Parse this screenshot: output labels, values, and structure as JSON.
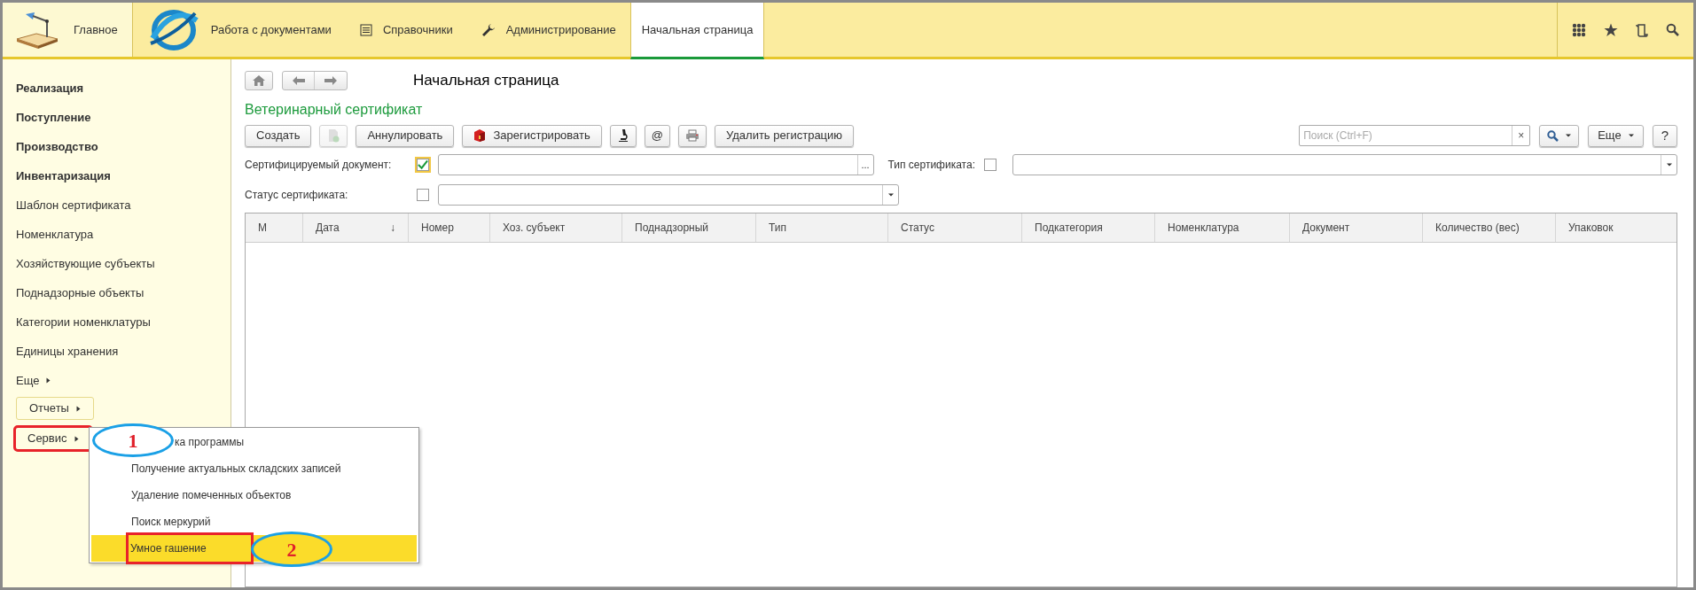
{
  "top_nav": {
    "items": [
      {
        "label": "Главное",
        "kind": "home",
        "selected": false
      },
      {
        "label": "Работа с документами",
        "kind": "section",
        "selected": false
      },
      {
        "label": "Справочники",
        "kind": "section",
        "selected": false
      },
      {
        "label": "Администрирование",
        "kind": "section",
        "selected": false
      },
      {
        "label": "Начальная страница",
        "kind": "tab",
        "selected": true
      }
    ]
  },
  "sidebar": {
    "items": [
      {
        "label": "Реализация",
        "bold": true
      },
      {
        "label": "Поступление",
        "bold": true
      },
      {
        "label": "Производство",
        "bold": true
      },
      {
        "label": "Инвентаризация",
        "bold": true
      },
      {
        "label": "Шаблон сертификата",
        "bold": false
      },
      {
        "label": "Номенклатура",
        "bold": false
      },
      {
        "label": "Хозяйствующие субъекты",
        "bold": false
      },
      {
        "label": "Поднадзорные объекты",
        "bold": false
      },
      {
        "label": "Категории номенклатуры",
        "bold": false
      },
      {
        "label": "Единицы хранения",
        "bold": false
      },
      {
        "label": "Еще",
        "bold": false,
        "kind": "submenu"
      }
    ],
    "buttons": [
      {
        "label": "Отчеты",
        "highlighted": false
      },
      {
        "label": "Сервис",
        "highlighted": true
      }
    ]
  },
  "popup_menu": {
    "items": [
      {
        "label": "ка программы",
        "selected": false
      },
      {
        "label": "Получение актуальных складских записей",
        "selected": false
      },
      {
        "label": "Удаление помеченных объектов",
        "selected": false
      },
      {
        "label": "Поиск меркурий",
        "selected": false
      },
      {
        "label": "Умное гашение",
        "selected": true
      }
    ]
  },
  "annotations": [
    {
      "number": "1"
    },
    {
      "number": "2"
    }
  ],
  "page": {
    "title": "Начальная страница",
    "subtitle": "Ветеринарный сертификат",
    "toolbar": [
      {
        "kind": "text",
        "label": "Создать",
        "disabled": false
      },
      {
        "kind": "icon",
        "disabled": true
      },
      {
        "kind": "text",
        "label": "Аннулировать",
        "disabled": false
      },
      {
        "kind": "icon_text",
        "label": "Зарегистрировать",
        "disabled": false
      },
      {
        "kind": "icon",
        "disabled": false
      },
      {
        "kind": "text",
        "label": "@",
        "disabled": false
      },
      {
        "kind": "icon",
        "disabled": false
      },
      {
        "kind": "text",
        "label": "Удалить регистрацию",
        "disabled": false
      }
    ],
    "search": {
      "placeholder": "Поиск (Ctrl+F)",
      "clear": "×"
    },
    "more_button": "Еще",
    "help_button": "?",
    "filters": [
      {
        "label": "Сертифицируемый документ:",
        "checked": true,
        "focused": true,
        "kind": "select_button",
        "button": "..."
      },
      {
        "label": "Тип сертификата:",
        "checked": false,
        "focused": false,
        "kind": "dropdown"
      },
      {
        "label": "Статус сертификата:",
        "checked": false,
        "focused": false,
        "kind": "dropdown"
      }
    ],
    "table": {
      "columns": [
        {
          "label": "М"
        },
        {
          "label": "Дата",
          "sort": "↓"
        },
        {
          "label": "Номер"
        },
        {
          "label": "Хоз. субъект"
        },
        {
          "label": "Поднадзорный"
        },
        {
          "label": "Тип"
        },
        {
          "label": "Статус"
        },
        {
          "label": "Подкатегория"
        },
        {
          "label": "Номенклатура"
        },
        {
          "label": "Документ"
        },
        {
          "label": "Количество (вес)"
        },
        {
          "label": "Упаковок"
        }
      ]
    }
  }
}
